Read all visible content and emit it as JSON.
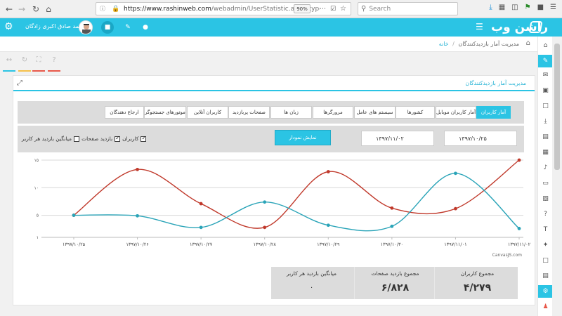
{
  "browser": {
    "url_host": "https://www.rashinweb.com",
    "url_path": "/webadmin/UserStatistic.aspx?type=",
    "zoom": "90%",
    "search_placeholder": "Search"
  },
  "header": {
    "logo": "راشن وب",
    "user_name": "محمد صادق اکبری زادگان"
  },
  "breadcrumb": {
    "home": "خانه",
    "separator": "/",
    "current": "مدیریت آمار بازدیدکنندگان"
  },
  "panel": {
    "title": "مدیریت آمار بازدیدکنندگان"
  },
  "tabs": [
    {
      "label": "آمار کاربران",
      "active": true
    },
    {
      "label": "آمار کاربران موبایل",
      "active": false
    },
    {
      "label": "کشورها",
      "active": false
    },
    {
      "label": "سیستم های عامل",
      "active": false
    },
    {
      "label": "مرورگرها",
      "active": false
    },
    {
      "label": "زبان ها",
      "active": false
    },
    {
      "label": "صفحات پربازدید",
      "active": false
    },
    {
      "label": "کاربران آنلاین",
      "active": false
    },
    {
      "label": "موتورهای جستجوگر",
      "active": false
    },
    {
      "label": "ارجاع دهندگان",
      "active": false
    }
  ],
  "filters": {
    "date_from": "۱۳۹۷/۱۰/۲۵",
    "date_to": "۱۳۹۷/۱۱/۰۲",
    "show_button": "نمایش نمودار",
    "checkbox_users": "کاربران",
    "checkbox_pageviews": "بازدید صفحات",
    "checkbox_avg": "میانگین بازدید هر کاربر"
  },
  "chart_data": {
    "type": "line",
    "x": [
      "۱۳۹۷/۱۰/۲۵",
      "۱۳۹۷/۱۰/۲۶",
      "۱۳۹۷/۱۰/۲۷",
      "۱۳۹۷/۱۰/۲۸",
      "۱۳۹۷/۱۰/۲۹",
      "۱۳۹۷/۱۰/۳۰",
      "۱۳۹۷/۱۱/۰۱",
      "۱۳۹۷/۱۱/۰۲"
    ],
    "y_ticks": [
      "۱۵",
      "۱۰",
      "۵",
      "۱"
    ],
    "ylim": [
      1,
      15
    ],
    "series": [
      {
        "color": "#c0392b",
        "values": [
          5.0,
          13.3,
          7.1,
          2.8,
          12.9,
          6.3,
          6.2,
          15.0
        ]
      },
      {
        "color": "#2aa4b8",
        "values": [
          5.0,
          4.9,
          2.8,
          7.4,
          3.2,
          3.0,
          12.6,
          2.6
        ]
      }
    ],
    "credit": "CanvasJS.com"
  },
  "stats": [
    {
      "label": "مجموع کاربران",
      "value": "۴/۲۷۹"
    },
    {
      "label": "مجموع بازدید صفحات",
      "value": "۶/۸۲۸"
    },
    {
      "label": "میانگین بازدید هر کاربر",
      "value": "۰"
    }
  ],
  "colors": {
    "accent": "#2bc4e4",
    "tool_bars": [
      "#2bc4e4",
      "#f5c04a",
      "#e8584a",
      "#e8584a"
    ]
  }
}
